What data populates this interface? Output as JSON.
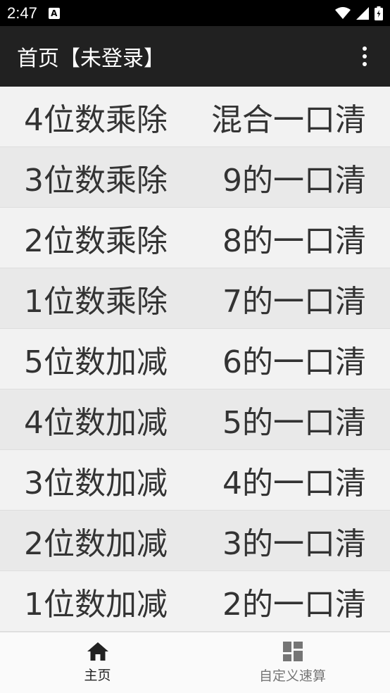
{
  "status_bar": {
    "time": "2:47",
    "notification_glyph": "A",
    "icons": [
      "wifi-icon",
      "signal-icon",
      "battery-icon"
    ]
  },
  "app_bar": {
    "title": "首页【未登录】",
    "menu_icon": "more-vert-icon"
  },
  "rows": [
    {
      "left": "4位数乘除",
      "right": "混合一口清"
    },
    {
      "left": "3位数乘除",
      "right": "9的一口清"
    },
    {
      "left": "2位数乘除",
      "right": "8的一口清"
    },
    {
      "left": "1位数乘除",
      "right": "7的一口清"
    },
    {
      "left": "5位数加减",
      "right": "6的一口清"
    },
    {
      "left": "4位数加减",
      "right": "5的一口清"
    },
    {
      "left": "3位数加减",
      "right": "4的一口清"
    },
    {
      "left": "2位数加减",
      "right": "3的一口清"
    },
    {
      "left": "1位数加减",
      "right": "2的一口清"
    }
  ],
  "bottom_nav": {
    "items": [
      {
        "label": "主页",
        "icon": "home-icon",
        "active": true
      },
      {
        "label": "自定义速算",
        "icon": "dashboard-icon",
        "active": false
      }
    ]
  },
  "colors": {
    "status_bar": "#000000",
    "app_bar": "#212121",
    "row_odd": "#f2f2f2",
    "row_even": "#e9e9e9",
    "text": "#333333",
    "nav_active": "#222222",
    "nav_inactive": "#757575"
  }
}
